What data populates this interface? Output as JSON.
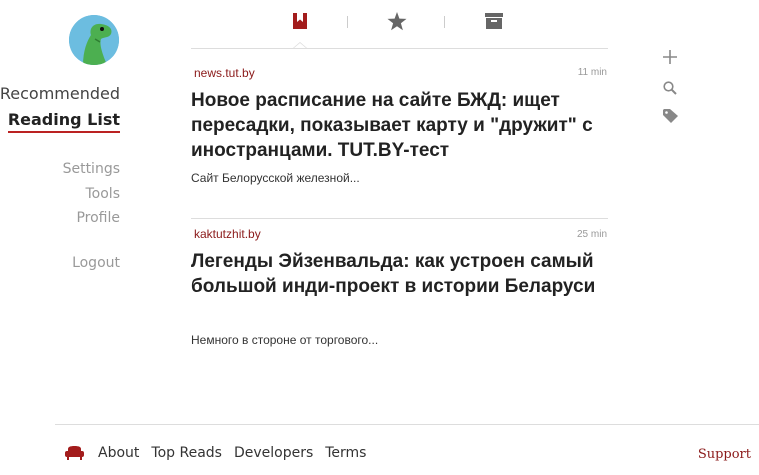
{
  "nav": {
    "recommended": "Recommended",
    "reading_list": "Reading List",
    "settings": "Settings",
    "tools": "Tools",
    "profile": "Profile",
    "logout": "Logout"
  },
  "tabs": [
    "reading-list-icon",
    "favorites-star-icon",
    "archive-icon"
  ],
  "tools": [
    "add-plus-icon",
    "search-icon",
    "tag-icon"
  ],
  "articles": [
    {
      "source": "news.tut.by",
      "time": "11 min",
      "title": "Новое расписание на сайте БЖД: ищет пересадки, показывает карту и \"дружит\" с иностранцами. TUT.BY-тест",
      "excerpt": "Сайт Белорусской железной..."
    },
    {
      "source": "kaktutzhit.by",
      "time": "25 min",
      "title": "Легенды Эйзенвальда: как устроен самый большой инди-проект в истории Беларуси",
      "excerpt": "Немного в стороне от торгового..."
    }
  ],
  "footer": {
    "about": "About",
    "top_reads": "Top Reads",
    "developers": "Developers",
    "terms": "Terms",
    "support": "Support"
  },
  "colors": {
    "accent": "#8b1a1a",
    "active_underline": "#bb2222"
  }
}
